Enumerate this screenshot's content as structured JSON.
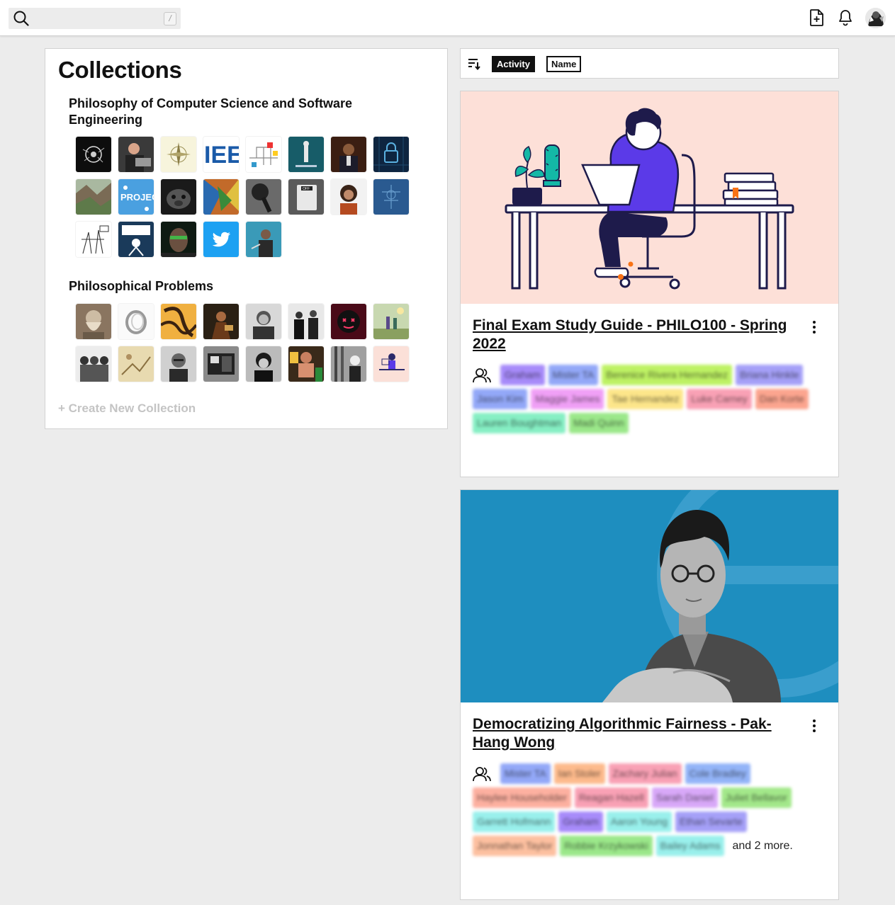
{
  "topbar": {
    "search_placeholder": "",
    "search_shortcut": "/",
    "icons": [
      "search-icon",
      "new-document-icon",
      "bell-icon",
      "avatar"
    ]
  },
  "collections": {
    "heading": "Collections",
    "items": [
      {
        "title": "Philosophy of Computer Science and Software Engineering",
        "thumbnail_count": 20
      },
      {
        "title": "Philosophical Problems",
        "thumbnail_count": 16
      }
    ],
    "create_label": "+ Create New Collection"
  },
  "sort": {
    "icon": "sort-icon",
    "options": [
      {
        "label": "Activity",
        "active": true
      },
      {
        "label": "Name",
        "active": false
      }
    ]
  },
  "cards": [
    {
      "title": "Final Exam Study Guide - PHILO100 - Spring 2022",
      "image": "illustration of student at desk with laptop",
      "participants": [
        {
          "name": "Graham",
          "color": "#a78bfa"
        },
        {
          "name": "Mister TA",
          "color": "#93a8f8"
        },
        {
          "name": "Berenice Rivera Hernandez",
          "color": "#bef264"
        },
        {
          "name": "Briana Hinkle",
          "color": "#a5a0f8"
        },
        {
          "name": "Jason Kim",
          "color": "#93a8f8"
        },
        {
          "name": "Maggie James",
          "color": "#f0a0f6"
        },
        {
          "name": "Tae Hernandez",
          "color": "#fde68a"
        },
        {
          "name": "Luke Carney",
          "color": "#f9a1b5"
        },
        {
          "name": "Dan Korte",
          "color": "#fca58f"
        },
        {
          "name": "Lauren Boughtman",
          "color": "#86efc4"
        },
        {
          "name": "Madi Quinn",
          "color": "#9be88a"
        }
      ],
      "more": ""
    },
    {
      "title": "Democratizing Algorithmic Fairness - Pak-Hang Wong",
      "image": "speaker portrait on blue background",
      "participants": [
        {
          "name": "Mister TA",
          "color": "#93a8f8"
        },
        {
          "name": "Ian Stoler",
          "color": "#fdba8c"
        },
        {
          "name": "Zachary Julian",
          "color": "#f9a1b5"
        },
        {
          "name": "Cole Bradley",
          "color": "#93b4f8"
        },
        {
          "name": "Haylee Householder",
          "color": "#fdb0a0"
        },
        {
          "name": "Reagan Hazell",
          "color": "#f9a1b5"
        },
        {
          "name": "Sarah Daniel",
          "color": "#d8a8f8"
        },
        {
          "name": "Juliet Bellavor",
          "color": "#a3e88a"
        },
        {
          "name": "Garrett Hofmann",
          "color": "#99f0ec"
        },
        {
          "name": "Graham",
          "color": "#a78bfa"
        },
        {
          "name": "Aaron Young",
          "color": "#99f0ec"
        },
        {
          "name": "Ethan Sevarte",
          "color": "#a5a0f8"
        },
        {
          "name": "Jonnathan Taylor",
          "color": "#fdc0a0"
        },
        {
          "name": "Robbie Krzykowski",
          "color": "#9be88a"
        },
        {
          "name": "Bailey Adams",
          "color": "#99f0ec"
        }
      ],
      "more": "and 2 more."
    }
  ]
}
